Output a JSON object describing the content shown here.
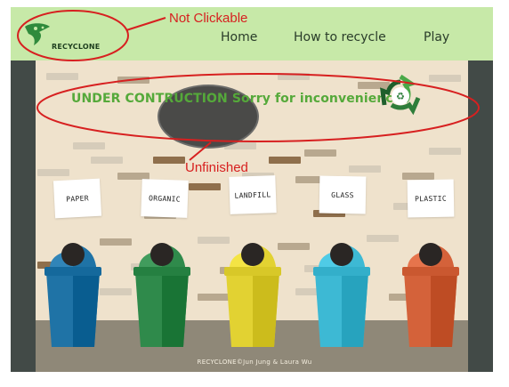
{
  "nav": {
    "logo_text": "RECYCLONE",
    "links": [
      "Home",
      "How to recycle",
      "Play"
    ]
  },
  "banner": {
    "text": "UNDER CONTRUCTION Sorry for inconvenience"
  },
  "signs": [
    "PAPER",
    "ORGANIC",
    "LANDFILL",
    "GLASS",
    "PLASTIC"
  ],
  "bins": [
    {
      "name": "paper",
      "color": "#1f73a6"
    },
    {
      "name": "organic",
      "color": "#2f8a4b"
    },
    {
      "name": "landfill",
      "color": "#e2d232"
    },
    {
      "name": "glass",
      "color": "#3db9d4"
    },
    {
      "name": "plastic",
      "color": "#d4623a"
    }
  ],
  "footer": {
    "text": "RECYCLONE©Jun Jung & Laura Wu"
  },
  "annotations": {
    "not_clickable": "Not Clickable",
    "unfinished": "Unfinished",
    "color": "#d72020"
  },
  "colors": {
    "nav_bg": "#c7e9a8",
    "wall": "#efe2cc",
    "banner_text": "#55a93a"
  }
}
